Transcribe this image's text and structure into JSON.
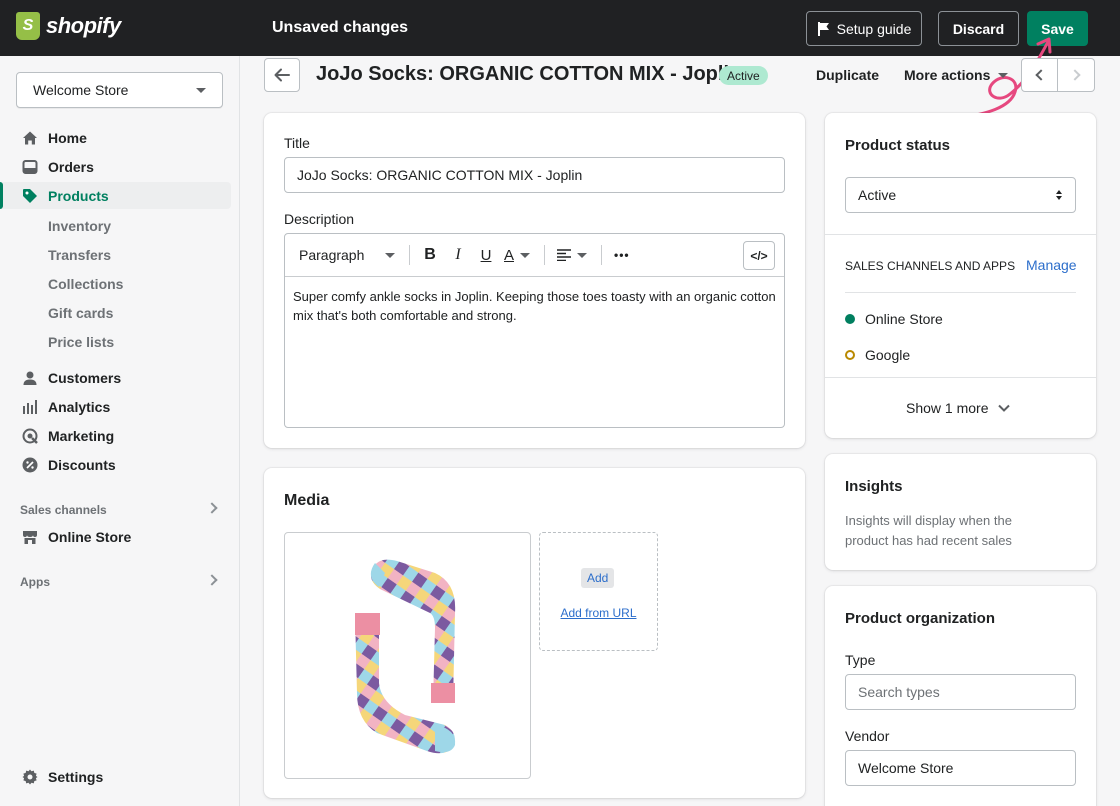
{
  "topbar": {
    "logo_text": "shopify",
    "logo_letter": "S",
    "unsaved": "Unsaved changes",
    "setup_guide": "Setup guide",
    "discard": "Discard",
    "save": "Save",
    "colors": {
      "bar": "#202123",
      "save": "#008060",
      "brand": "#95bf47"
    }
  },
  "sidebar": {
    "store": "Welcome Store",
    "items": [
      {
        "label": "Home",
        "icon": "home-icon"
      },
      {
        "label": "Orders",
        "icon": "orders-icon"
      },
      {
        "label": "Products",
        "icon": "tag-icon"
      }
    ],
    "product_sub": [
      "Inventory",
      "Transfers",
      "Collections",
      "Gift cards",
      "Price lists"
    ],
    "items2": [
      {
        "label": "Customers",
        "icon": "person-icon"
      },
      {
        "label": "Analytics",
        "icon": "bar-chart-icon"
      },
      {
        "label": "Marketing",
        "icon": "target-icon"
      },
      {
        "label": "Discounts",
        "icon": "discount-icon"
      }
    ],
    "sales_channels": "Sales channels",
    "online_store": "Online Store",
    "apps": "Apps",
    "settings": "Settings"
  },
  "header": {
    "title": "JoJo Socks: ORGANIC COTTON MIX - Joplin",
    "status": "Active",
    "duplicate": "Duplicate",
    "more_actions": "More actions"
  },
  "main": {
    "title_label": "Title",
    "title_value": "JoJo Socks: ORGANIC COTTON MIX - Joplin",
    "description_label": "Description",
    "toolbar": {
      "paragraph": "Paragraph",
      "bold": "B",
      "italic": "I",
      "underline": "U",
      "color": "A",
      "more": "•••",
      "code": "</>"
    },
    "description": "Super comfy ankle socks in Joplin. Keeping those toes toasty with an organic cotton mix that's both comfortable and strong.",
    "media_title": "Media",
    "media_add": "Add",
    "media_add_url": "Add from URL"
  },
  "right": {
    "status_title": "Product status",
    "status_value": "Active",
    "sales_title": "SALES CHANNELS AND APPS",
    "manage": "Manage",
    "channels": [
      "Online Store",
      "Google"
    ],
    "show_more": "Show 1 more",
    "insights_title": "Insights",
    "insights_text": "Insights will display when the product has had recent sales",
    "org_title": "Product organization",
    "type_label": "Type",
    "type_placeholder": "Search types",
    "vendor_label": "Vendor",
    "vendor_value": "Welcome Store"
  }
}
